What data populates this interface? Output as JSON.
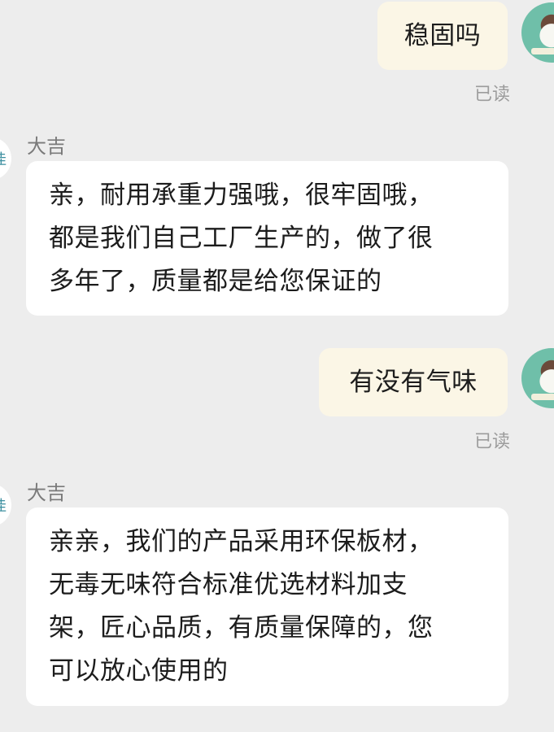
{
  "messages": [
    {
      "sender": "me",
      "text": "稳固吗",
      "status": "已读"
    },
    {
      "sender": "大吉",
      "lines": [
        "亲，耐用承重力强哦，很牢固哦，",
        "都是我们自己工厂生产的，做了很",
        "多年了，质量都是给您保证的"
      ]
    },
    {
      "sender": "me",
      "text": "有没有气味",
      "status": "已读"
    },
    {
      "sender": "大吉",
      "lines": [
        "亲亲，我们的产品采用环保板材，",
        "无毒无味符合标准优选材料加支",
        "架，匠心品质，有质量保障的，您",
        "可以放心使用的"
      ]
    }
  ],
  "shop_avatar_glyph": "佳",
  "colors": {
    "background": "#ededed",
    "my_bubble": "#fbf6e6",
    "their_bubble": "#ffffff",
    "read_text": "#9c9c9c"
  },
  "icons": {
    "my_avatar": "user-avatar-icon",
    "shop_avatar": "shop-avatar-icon"
  }
}
